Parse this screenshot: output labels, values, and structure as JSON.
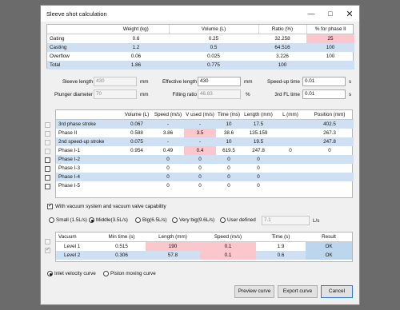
{
  "window": {
    "title": "Sleeve shot calculation",
    "minimize_icon": "minimize-icon",
    "maximize_icon": "maximize-icon",
    "close_icon": "close-icon"
  },
  "summary": {
    "headers": [
      "",
      "Weight (kg)",
      "Volume (L)",
      "Ratio (%)",
      "% for phase II"
    ],
    "rows": [
      {
        "name": "Gating",
        "weight": "0.6",
        "volume": "0.25",
        "ratio": "32.258",
        "pct": "25"
      },
      {
        "name": "Casting",
        "weight": "1.2",
        "volume": "0.5",
        "ratio": "64.516",
        "pct": "100"
      },
      {
        "name": "Overflow",
        "weight": "0.06",
        "volume": "0.025",
        "ratio": "3.226",
        "pct": "100"
      },
      {
        "name": "Total",
        "weight": "1.86",
        "volume": "0.775",
        "ratio": "100",
        "pct": ""
      }
    ]
  },
  "params": {
    "sleeve_length_label": "Sleeve length",
    "sleeve_length": "430",
    "sleeve_length_unit": "mm",
    "effective_length_label": "Effective length",
    "effective_length": "430",
    "effective_length_unit": "mm",
    "speedup_time_label": "Speed-up time",
    "speedup_time": "0.01",
    "speedup_time_unit": "s",
    "plunger_diameter_label": "Plunger diameter",
    "plunger_diameter": "70",
    "plunger_diameter_unit": "mm",
    "filling_ratio_label": "Filling ratio",
    "filling_ratio": "46.83",
    "filling_ratio_unit": "%",
    "fl_time_label": "3rd FL time",
    "fl_time": "0.01",
    "fl_time_unit": "s"
  },
  "phases": {
    "headers": [
      "",
      "Volume (L)",
      "Speed (m/s)",
      "V used (m/s)",
      "Time (ms)",
      "Length (mm)",
      "L (mm)",
      "Position (mm)"
    ],
    "rows": [
      {
        "name": "3rd phase stroke",
        "volume": "0.067",
        "speed": "-",
        "vused": "-",
        "time": "10",
        "length": "17.5",
        "l": "",
        "position": "402.5"
      },
      {
        "name": "Phase II",
        "volume": "0.588",
        "speed": "3.86",
        "vused": "3.5",
        "time": "38.6",
        "length": "135.159",
        "l": "",
        "position": "267.3"
      },
      {
        "name": "2nd speed-up stroke",
        "volume": "0.075",
        "speed": "-",
        "vused": "-",
        "time": "10",
        "length": "19.5",
        "l": "",
        "position": "247.8"
      },
      {
        "name": "Phase I-1",
        "volume": "0.954",
        "speed": "0.49",
        "vused": "0.4",
        "time": "619.5",
        "length": "247.8",
        "l": "0",
        "position": "0"
      },
      {
        "name": "Phase I-2",
        "volume": "",
        "speed": "0",
        "vused": "0",
        "time": "0",
        "length": "0",
        "l": "",
        "position": ""
      },
      {
        "name": "Phase I-3",
        "volume": "",
        "speed": "0",
        "vused": "0",
        "time": "0",
        "length": "0",
        "l": "",
        "position": ""
      },
      {
        "name": "Phase I-4",
        "volume": "",
        "speed": "0",
        "vused": "0",
        "time": "0",
        "length": "0",
        "l": "",
        "position": ""
      },
      {
        "name": "Phase I-5",
        "volume": "",
        "speed": "0",
        "vused": "0",
        "time": "0",
        "length": "0",
        "l": "",
        "position": ""
      }
    ]
  },
  "vacuum_option": {
    "label": "With vacuum system and vacuum valve capability",
    "checked": true
  },
  "sizes": {
    "options": [
      "Small (1.5L/s)",
      "Middle(3.5L/s)",
      "Big(6.5L/s)",
      "Very big(9.6L/s)",
      "User defined"
    ],
    "selected": "Middle(3.5L/s)",
    "user_value": "7.1",
    "user_unit": "L/s"
  },
  "vacuum_table": {
    "headers": [
      "Vacuum",
      "Min time (s)",
      "Length (mm)",
      "Speed (m/s)",
      "Time (s)",
      "Result"
    ],
    "rows": [
      {
        "name": "Level 1",
        "min_time": "0.515",
        "length": "190",
        "speed": "0.1",
        "time": "1.9",
        "result": "OK"
      },
      {
        "name": "Level 2",
        "min_time": "0.306",
        "length": "57.8",
        "speed": "0.1",
        "time": "0.6",
        "result": "OK"
      }
    ]
  },
  "curve": {
    "options": [
      "Inlet velocity curve",
      "Piston moving curve"
    ],
    "selected": "Inlet velocity curve"
  },
  "buttons": {
    "preview": "Preview curve",
    "export": "Export curve",
    "cancel": "Cancel"
  }
}
